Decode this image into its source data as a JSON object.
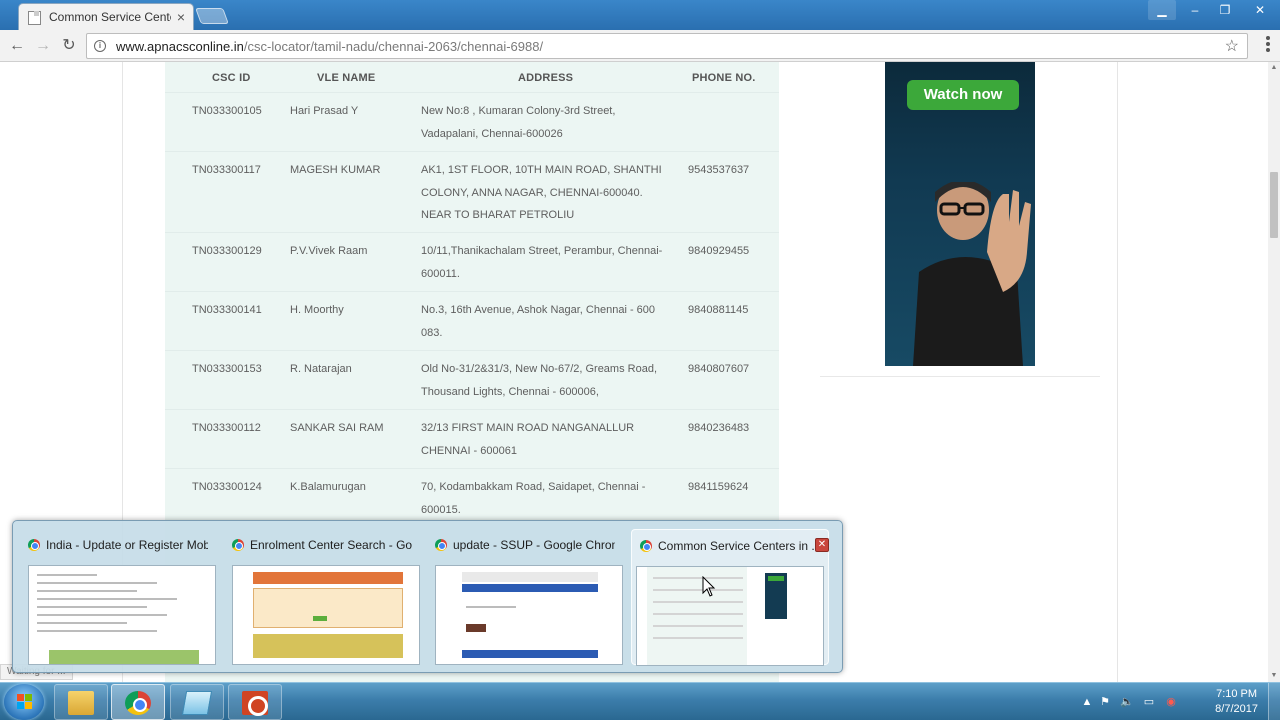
{
  "browser": {
    "tab_title": "Common Service Centers in",
    "url_host": "www.apnacsconline.in",
    "url_path": "/csc-locator/tamil-nadu/chennai-2063/chennai-6988/",
    "status_text": "Waiting for ..."
  },
  "table": {
    "headers": {
      "id": "CSC ID",
      "name": "VLE NAME",
      "address": "ADDRESS",
      "phone": "PHONE NO."
    },
    "rows": [
      {
        "id": "TN033300105",
        "name": "Hari Prasad Y",
        "address": "New No:8 , Kumaran Colony-3rd Street, Vadapalani, Chennai-600026",
        "phone": ""
      },
      {
        "id": "TN033300117",
        "name": "MAGESH KUMAR",
        "address": "AK1, 1ST FLOOR, 10TH MAIN ROAD, SHANTHI COLONY, ANNA NAGAR, CHENNAI-600040. NEAR TO BHARAT PETROLIU",
        "phone": "9543537637"
      },
      {
        "id": "TN033300129",
        "name": "P.V.Vivek Raam",
        "address": "10/11,Thanikachalam Street, Perambur, Chennai-600011.",
        "phone": "9840929455"
      },
      {
        "id": "TN033300141",
        "name": "H. Moorthy",
        "address": "No.3, 16th Avenue, Ashok Nagar, Chennai - 600 083.",
        "phone": "9840881145"
      },
      {
        "id": "TN033300153",
        "name": "R. Natarajan",
        "address": "Old No-31/2&31/3, New No-67/2, Greams Road, Thousand Lights, Chennai - 600006,",
        "phone": "9840807607"
      },
      {
        "id": "TN033300112",
        "name": "SANKAR SAI RAM",
        "address": "32/13 FIRST MAIN ROAD NANGANALLUR CHENNAI - 600061",
        "phone": "9840236483"
      },
      {
        "id": "TN033300124",
        "name": "K.Balamurugan",
        "address": "70, Kodambakkam Road, Saidapet, Chennai - 600015.",
        "phone": "9841159624"
      }
    ]
  },
  "ad": {
    "button_label": "Watch now"
  },
  "thumbnails": [
    {
      "title": "India - Update or Register Mobil..."
    },
    {
      "title": "Enrolment Center Search - Goo..."
    },
    {
      "title": "update - SSUP - Google Chrome"
    },
    {
      "title": "Common Service Centers in ..."
    }
  ],
  "taskbar": {
    "time": "7:10 PM",
    "date": "8/7/2017"
  },
  "colors": {
    "table_bg": "#ecf6f3",
    "ad_button": "#3ca83a",
    "taskbar": "#3c7dab"
  }
}
